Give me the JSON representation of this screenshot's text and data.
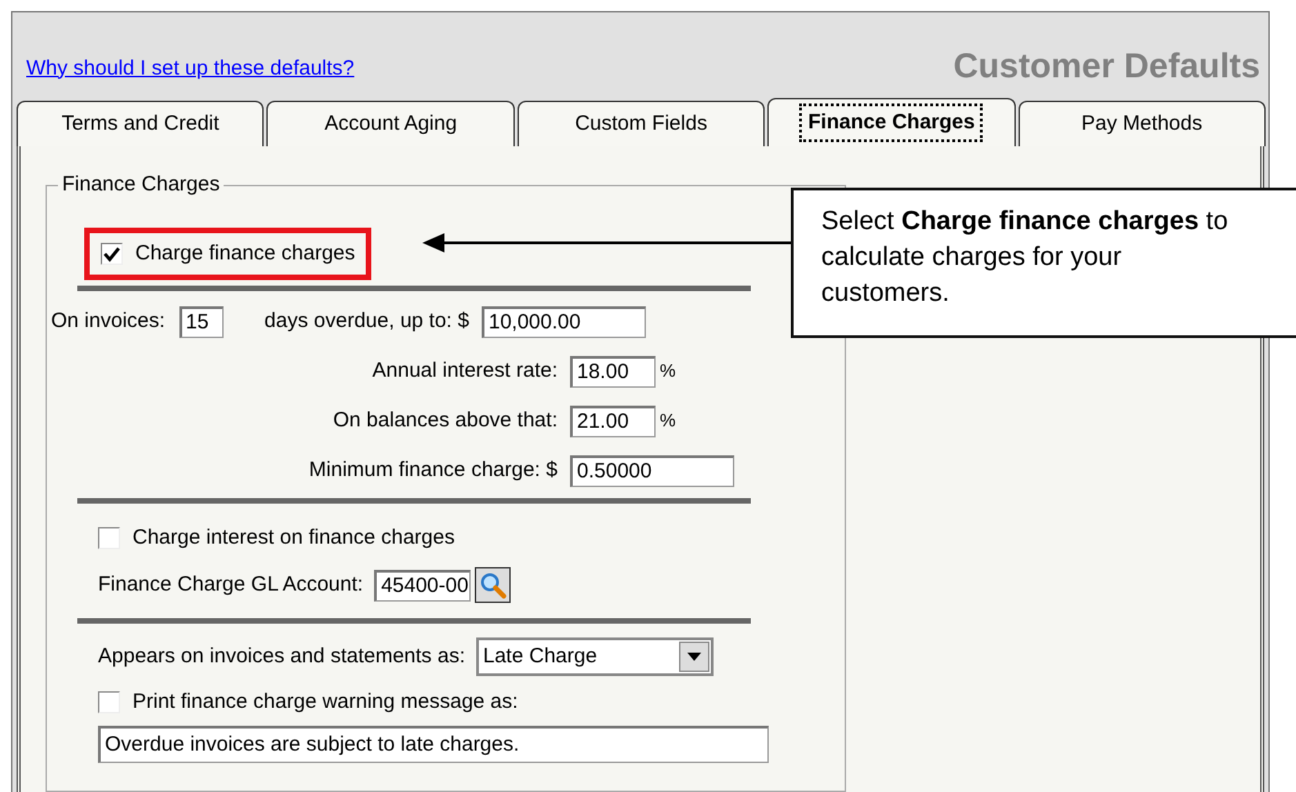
{
  "header": {
    "help_link": "Why should I set up these defaults?",
    "title": "Customer Defaults"
  },
  "tabs": [
    {
      "label": "Terms and Credit",
      "selected": false
    },
    {
      "label": "Account Aging",
      "selected": false
    },
    {
      "label": "Custom Fields",
      "selected": false
    },
    {
      "label": "Finance Charges",
      "selected": true
    },
    {
      "label": "Pay Methods",
      "selected": false
    }
  ],
  "finance_charges": {
    "legend": "Finance Charges",
    "charge_checkbox": {
      "label": "Charge finance charges",
      "checked": true,
      "highlighted": true
    },
    "on_invoices": {
      "label": "On invoices:",
      "days_value": "15",
      "days_label": "days overdue, up to: $",
      "amount_value": "10,000.00"
    },
    "fields": [
      {
        "label": "Annual interest rate:",
        "value": "18.00",
        "unit": "%",
        "kind": "percent"
      },
      {
        "label": "On balances above that:",
        "value": "21.00",
        "unit": "%",
        "kind": "percent"
      },
      {
        "label": "Minimum finance charge: $",
        "value": "0.50000",
        "kind": "amount"
      }
    ],
    "interest_checkbox": {
      "label": "Charge interest on finance charges",
      "checked": false
    },
    "gl_account": {
      "label": "Finance Charge GL Account:",
      "value": "45400-00"
    },
    "appears_as": {
      "label": "Appears on invoices and statements as:",
      "value": "Late Charge"
    },
    "warning_checkbox": {
      "label": "Print finance charge warning message as:",
      "checked": false
    },
    "warning_message": {
      "value": "Overdue invoices are subject to late charges."
    }
  },
  "callout": {
    "text": "Select **Charge finance charges** to calculate charges for your customers."
  }
}
